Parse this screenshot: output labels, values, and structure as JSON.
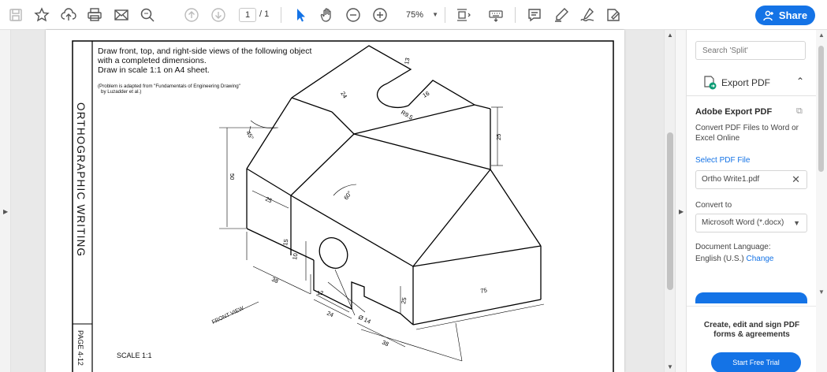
{
  "toolbar": {
    "page_current": "1",
    "page_total": "/ 1",
    "zoom": "75%",
    "share_label": "Share",
    "icons": [
      "save-icon",
      "bookmark-star-icon",
      "upload-cloud-icon",
      "print-icon",
      "email-icon",
      "find-icon",
      "page-up-icon",
      "page-down-icon",
      "select-cursor-icon",
      "hand-tool-icon",
      "zoom-out-icon",
      "zoom-in-icon",
      "fit-page-icon",
      "keyboard-icon",
      "comment-icon",
      "highlight-pen-icon",
      "sign-icon",
      "fill-sign-icon"
    ]
  },
  "document": {
    "side_title": "ORTHOGRAPHIC WRITING",
    "page_label": "PAGE 4-12",
    "instruction_lines": [
      "Draw front, top, and right-side views of the following object",
      "with a completed dimensions.",
      "Draw in scale 1:1 on A4 sheet."
    ],
    "note_lines": [
      "(Problem is adapted from \"Fundamentals of Engineering Drawing\"",
      "by Luzadder et al.)"
    ],
    "scale": "SCALE 1:1",
    "front_view_label": "FRONT VIEW",
    "dimensions": {
      "d24_top": "24",
      "d13": "13",
      "d16": "16",
      "r95": "R9.5",
      "angle45": "45°",
      "d50": "50",
      "d25_right": "25",
      "d25_left": "25",
      "angle60": "60°",
      "d15": "15",
      "d10": "10",
      "d38_left": "38",
      "d12": "12",
      "d24_bottom": "24",
      "dia14": "Ø 14",
      "d25_bottom": "25",
      "d75": "75",
      "d38_bottom": "38"
    }
  },
  "right_panel": {
    "search_placeholder": "Search 'Split'",
    "tool_name": "Export PDF",
    "section_title": "Adobe Export PDF",
    "description": "Convert PDF Files to Word or Excel Online",
    "select_label": "Select PDF File",
    "file_name": "Ortho Write1.pdf",
    "convert_label": "Convert to",
    "convert_value": "Microsoft Word (*.docx)",
    "language_label": "Document Language:",
    "language_value": "English (U.S.)",
    "language_change": "Change",
    "promo_text": "Create, edit and sign PDF forms & agreements",
    "trial_button": "Start Free Trial"
  },
  "colors": {
    "accent": "#1473e6",
    "canvas": "#e9e9e9"
  }
}
